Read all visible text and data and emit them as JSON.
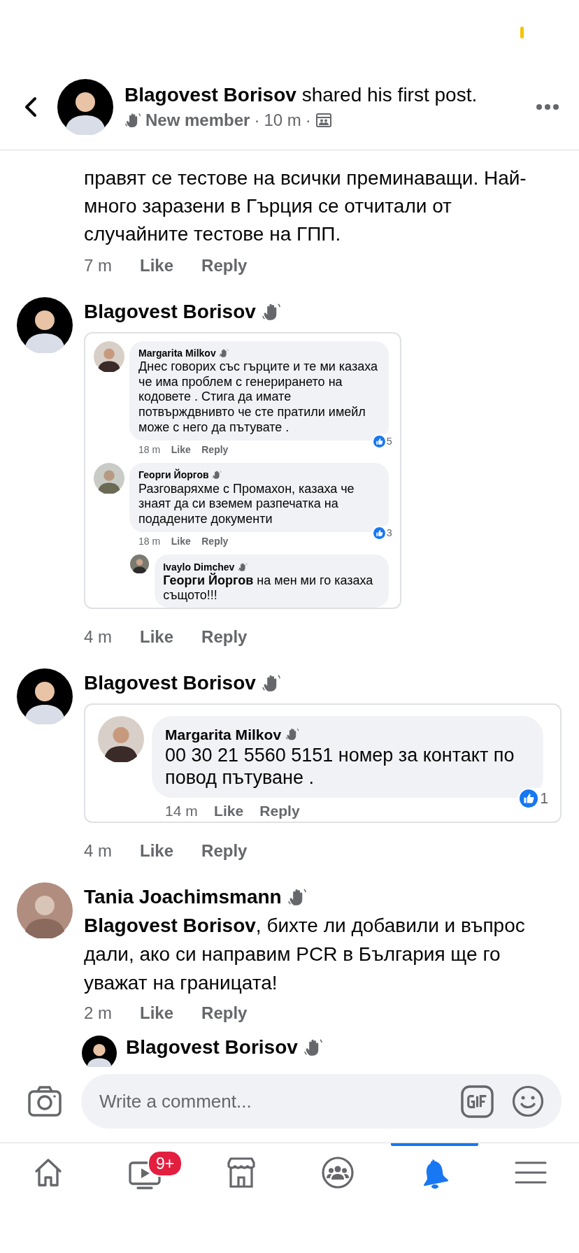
{
  "header": {
    "title": "**Blagovest Borisov** shared his first post.",
    "badge": "New member",
    "separator": "·",
    "time": "10 m"
  },
  "fragment": {
    "text": "правят се тестове на всички преминаващи. Най-много заразени в Гърция се отчитали от случайните тестове на ГПП.",
    "time": "7 m",
    "like": "Like",
    "reply": "Reply"
  },
  "comments": [
    {
      "author": "Blagovest Borisov",
      "kind": "screenshot",
      "embed": {
        "comments": [
          {
            "author": "Margarita Milkov",
            "text": "Днес говорих със гърците и те ми казаха че има проблем с генерирането на кодовете . Стига да имате потвърждвнивто че сте пратили имейл може с него да пътувате .",
            "time": "18 m",
            "like": "Like",
            "reply": "Reply",
            "reactions": "5"
          },
          {
            "author": "Георги Йоргов",
            "text": "Разговаряхме с Промахон, казаха че знаят да си вземем разпечатка на подадените документи",
            "time": "18 m",
            "like": "Like",
            "reply": "Reply",
            "reactions": "3",
            "children": [
              {
                "author": "Ivaylo Dimchev",
                "text": "**Георги Йоргов** на мен ми го казаха същото!!!"
              }
            ]
          }
        ]
      },
      "time": "4 m",
      "like": "Like",
      "reply": "Reply"
    },
    {
      "author": "Blagovest Borisov",
      "kind": "screenshot",
      "embed": {
        "comments": [
          {
            "author": "Margarita Milkov",
            "text": "00 30 21 5560 5151 номер за контакт по повод пътуване .",
            "time": "14 m",
            "like": "Like",
            "reply": "Reply",
            "reactions": "1"
          }
        ]
      },
      "time": "4 m",
      "like": "Like",
      "reply": "Reply"
    },
    {
      "author": "Tania Joachimsmann",
      "kind": "text",
      "text": "**Blagovest Borisov**, бихте ли добавили и въпрос дали, ако си направим PCR в България ще го уважат на границата!",
      "time": "2 m",
      "like": "Like",
      "reply": "Reply",
      "replies": [
        {
          "author": "Blagovest Borisov"
        }
      ]
    }
  ],
  "composer": {
    "placeholder": "Write a comment..."
  },
  "tabs": [
    {
      "kind": "home",
      "selected": false
    },
    {
      "kind": "video",
      "selected": false,
      "badge": "9+"
    },
    {
      "kind": "store",
      "selected": false
    },
    {
      "kind": "groups",
      "selected": false
    },
    {
      "kind": "bell",
      "selected": true
    },
    {
      "kind": "menu",
      "selected": false
    }
  ]
}
